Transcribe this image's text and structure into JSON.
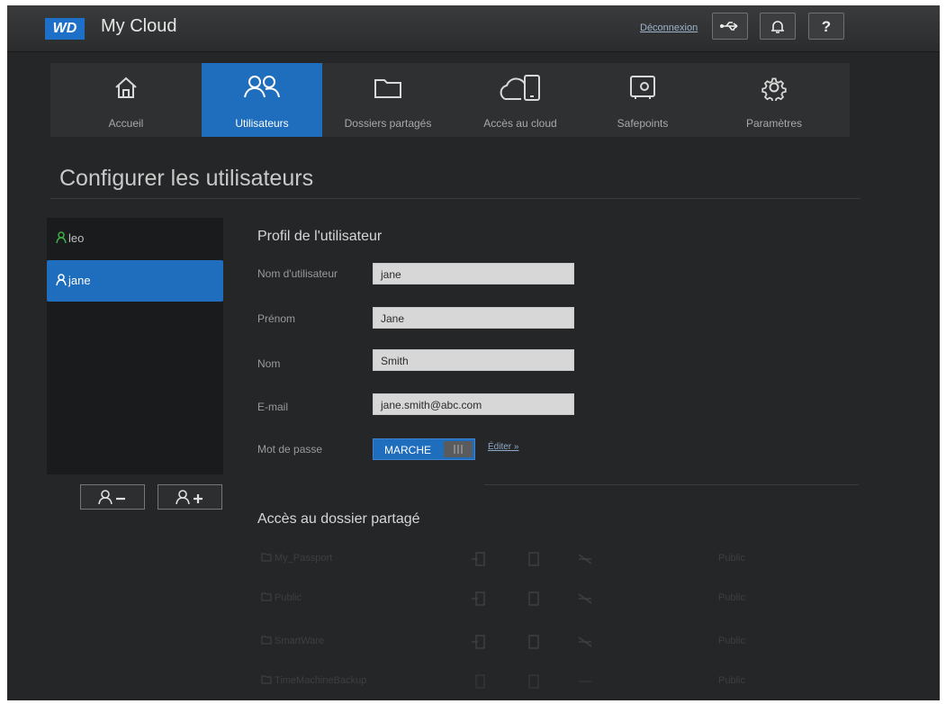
{
  "header": {
    "logo": "WD",
    "app_title": "My Cloud",
    "logout_label": "Déconnexion",
    "buttons": [
      {
        "icon": "usb-icon"
      },
      {
        "icon": "bell-icon"
      },
      {
        "icon": "help-icon",
        "glyph": "?"
      }
    ]
  },
  "nav": {
    "items": [
      {
        "label": "Accueil",
        "icon": "home-icon",
        "active": false
      },
      {
        "label": "Utilisateurs",
        "icon": "users-icon",
        "active": true
      },
      {
        "label": "Dossiers partagés",
        "icon": "folder-icon",
        "active": false
      },
      {
        "label": "Accès au cloud",
        "icon": "cloud-device-icon",
        "active": false
      },
      {
        "label": "Safepoints",
        "icon": "safe-icon",
        "active": false
      },
      {
        "label": "Paramètres",
        "icon": "gear-icon",
        "active": false
      }
    ]
  },
  "page_title": "Configurer les utilisateurs",
  "users": {
    "items": [
      {
        "name": "leo",
        "selected": false
      },
      {
        "name": "jane",
        "selected": true
      }
    ],
    "remove_button": {
      "icon": "remove-user-icon"
    },
    "add_button": {
      "icon": "add-user-icon"
    }
  },
  "profile": {
    "title": "Profil de l'utilisateur",
    "username_label": "Nom d'utilisateur",
    "username_value": "jane",
    "firstname_label": "Prénom",
    "firstname_value": "Jane",
    "lastname_label": "Nom",
    "lastname_value": "Smith",
    "email_label": "E-mail",
    "email_value": "jane.smith@abc.com",
    "password_label": "Mot de passe",
    "password_toggle": "MARCHE",
    "edit_link": "Éditer »"
  },
  "shares": {
    "title": "Accès au dossier partagé",
    "rows": [
      {
        "name": "My_Passport",
        "status": "Public"
      },
      {
        "name": "Public",
        "status": "Public"
      },
      {
        "name": "SmartWare",
        "status": "Public"
      },
      {
        "name": "TimeMachineBackup",
        "status": "Public"
      }
    ]
  },
  "colors": {
    "accent": "#1f6dbd",
    "background": "#252627",
    "user_icon_green": "#3fae49"
  }
}
